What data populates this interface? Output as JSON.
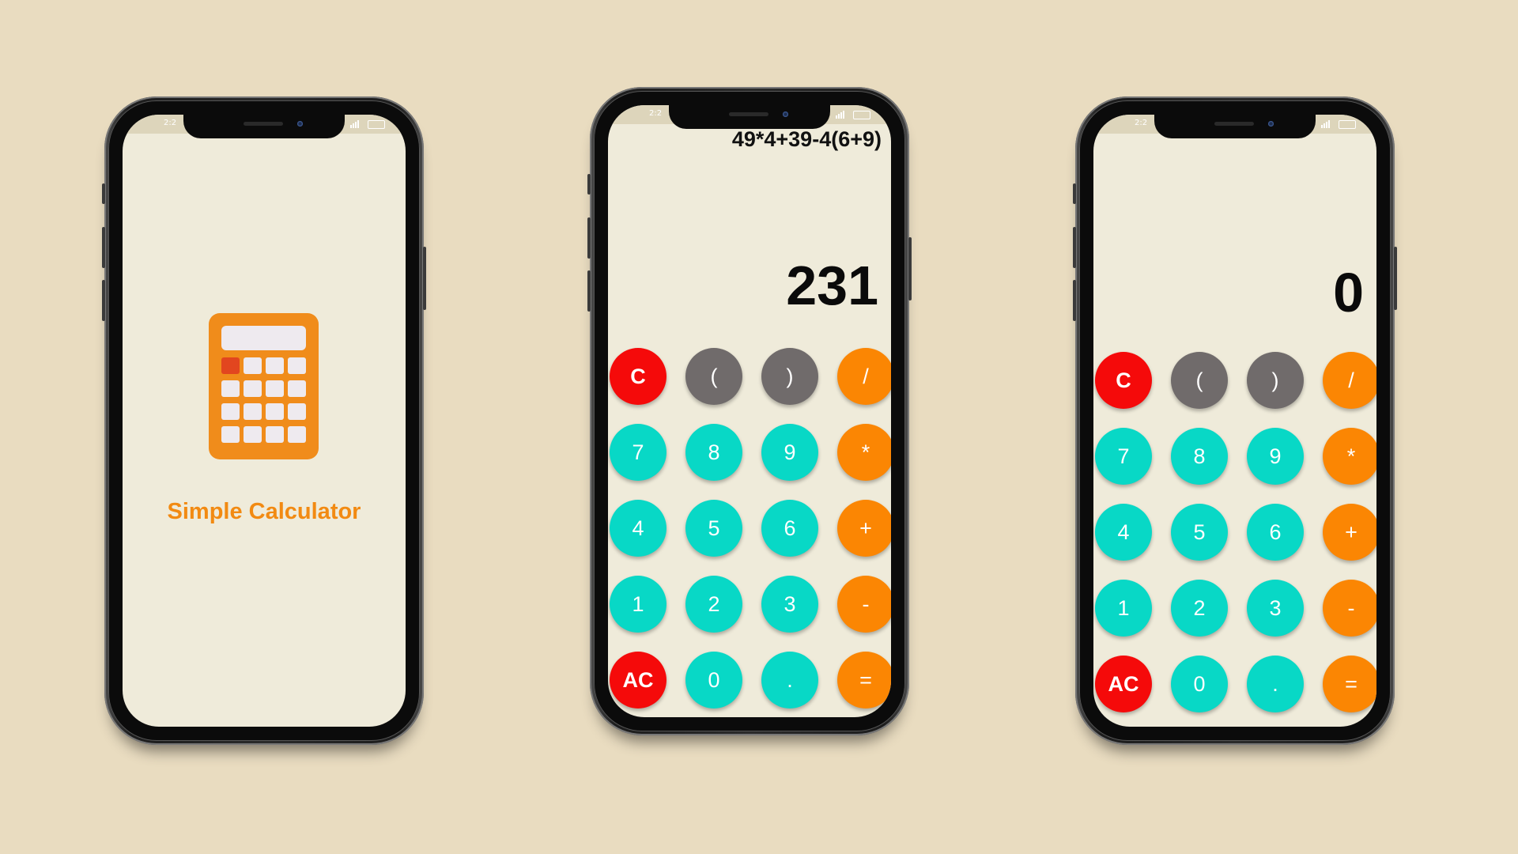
{
  "colors": {
    "background": "#e9dcc0",
    "screen": "#efebda",
    "key_red": "#f50a0a",
    "key_gray": "#706b6b",
    "key_teal": "#08d8c6",
    "key_orange": "#fb8603",
    "brand_orange": "#f28a12"
  },
  "phones": [
    {
      "kind": "splash",
      "status_time": "2:2",
      "app_icon": "calculator-icon",
      "app_name": "Simple Calculator"
    },
    {
      "kind": "calculator",
      "status_time": "2:2",
      "expression": "49*4+39-4(6+9)",
      "result": "231"
    },
    {
      "kind": "calculator",
      "status_time": "2:2",
      "expression": "",
      "result": "0"
    }
  ],
  "keypad": [
    [
      {
        "label": "C",
        "type": "red",
        "name": "clear"
      },
      {
        "label": "(",
        "type": "gray",
        "name": "open-paren"
      },
      {
        "label": ")",
        "type": "gray",
        "name": "close-paren"
      },
      {
        "label": "/",
        "type": "orange",
        "name": "divide"
      }
    ],
    [
      {
        "label": "7",
        "type": "teal",
        "name": "digit-7"
      },
      {
        "label": "8",
        "type": "teal",
        "name": "digit-8"
      },
      {
        "label": "9",
        "type": "teal",
        "name": "digit-9"
      },
      {
        "label": "*",
        "type": "orange",
        "name": "multiply"
      }
    ],
    [
      {
        "label": "4",
        "type": "teal",
        "name": "digit-4"
      },
      {
        "label": "5",
        "type": "teal",
        "name": "digit-5"
      },
      {
        "label": "6",
        "type": "teal",
        "name": "digit-6"
      },
      {
        "label": "+",
        "type": "orange",
        "name": "add"
      }
    ],
    [
      {
        "label": "1",
        "type": "teal",
        "name": "digit-1"
      },
      {
        "label": "2",
        "type": "teal",
        "name": "digit-2"
      },
      {
        "label": "3",
        "type": "teal",
        "name": "digit-3"
      },
      {
        "label": "-",
        "type": "orange",
        "name": "subtract"
      }
    ],
    [
      {
        "label": "AC",
        "type": "red",
        "name": "all-clear"
      },
      {
        "label": "0",
        "type": "teal",
        "name": "digit-0"
      },
      {
        "label": ".",
        "type": "teal",
        "name": "decimal-point"
      },
      {
        "label": "=",
        "type": "orange",
        "name": "equals"
      }
    ]
  ]
}
